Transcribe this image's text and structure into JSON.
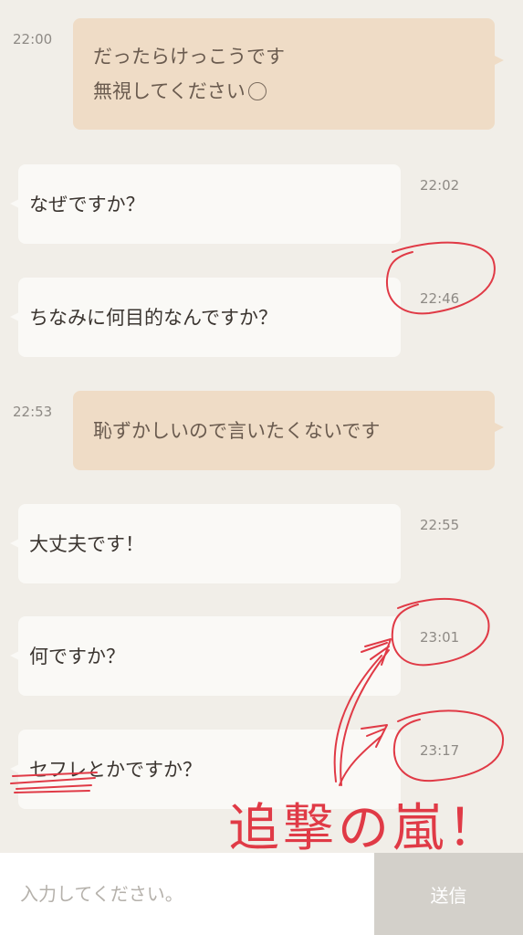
{
  "messages": [
    {
      "direction": "out",
      "text": "だったらけっこうです\n無視してください😂",
      "time": "22:00"
    },
    {
      "direction": "in",
      "text": "なぜですか？",
      "time": "22:02"
    },
    {
      "direction": "in",
      "text": "ちなみに何目的なんですか？",
      "time": "22:46"
    },
    {
      "direction": "out",
      "text": "恥ずかしいので言いたくないです",
      "time": "22:53"
    },
    {
      "direction": "in",
      "text": "大丈夫です！",
      "time": "22:55"
    },
    {
      "direction": "in",
      "text": "何ですか？",
      "time": "23:01"
    },
    {
      "direction": "in",
      "text": "セフレとかですか？",
      "time": "23:17"
    }
  ],
  "composer": {
    "placeholder": "入力してください。",
    "send_label": "送信"
  },
  "annotation": {
    "caption": "追撃の嵐！",
    "color": "#e03a46"
  },
  "colors": {
    "background": "#f1eee8",
    "outgoing_bubble": "#efdcc6",
    "incoming_bubble": "#faf9f6",
    "send_button": "#d3d0ca"
  }
}
